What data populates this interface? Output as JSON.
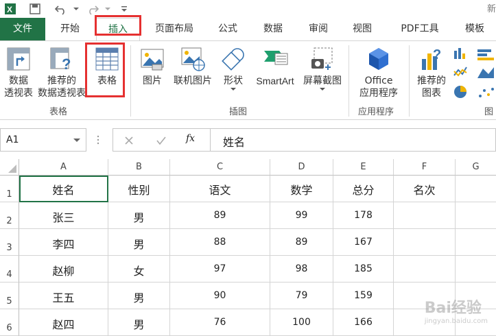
{
  "quick_access": {
    "title_fragment": "新"
  },
  "tabs": [
    {
      "label": "文件",
      "key": "file"
    },
    {
      "label": "开始",
      "key": "home"
    },
    {
      "label": "插入",
      "key": "insert"
    },
    {
      "label": "页面布局",
      "key": "page_layout"
    },
    {
      "label": "公式",
      "key": "formulas"
    },
    {
      "label": "数据",
      "key": "data"
    },
    {
      "label": "审阅",
      "key": "review"
    },
    {
      "label": "视图",
      "key": "view"
    },
    {
      "label": "PDF工具",
      "key": "pdf"
    },
    {
      "label": "模板",
      "key": "template"
    }
  ],
  "ribbon": {
    "pivot_table": "数据\n透视表",
    "recommended_pivot": "推荐的\n数据透视表",
    "table": "表格",
    "tables_group": "表格",
    "picture": "图片",
    "online_picture": "联机图片",
    "shapes": "形状",
    "smartart": "SmartArt",
    "screenshot": "屏幕截图",
    "illustrations_group": "插图",
    "office_apps": "Office\n应用程序",
    "apps_group": "应用程序",
    "recommended_charts": "推荐的\n图表",
    "charts_group_fragment": "图"
  },
  "formula_bar": {
    "name_box": "A1",
    "fx": "fx",
    "value": "姓名"
  },
  "columns": [
    "A",
    "B",
    "C",
    "D",
    "E",
    "F",
    "G"
  ],
  "rows": [
    {
      "n": "1",
      "cells": [
        "姓名",
        "性别",
        "语文",
        "数学",
        "总分",
        "名次"
      ]
    },
    {
      "n": "2",
      "cells": [
        "张三",
        "男",
        "89",
        "99",
        "178",
        ""
      ]
    },
    {
      "n": "3",
      "cells": [
        "李四",
        "男",
        "88",
        "89",
        "167",
        ""
      ]
    },
    {
      "n": "4",
      "cells": [
        "赵柳",
        "女",
        "97",
        "98",
        "185",
        ""
      ]
    },
    {
      "n": "5",
      "cells": [
        "王五",
        "男",
        "90",
        "79",
        "159",
        ""
      ]
    },
    {
      "n": "6",
      "cells": [
        "赵四",
        "男",
        "76",
        "100",
        "166",
        ""
      ]
    }
  ],
  "watermark": {
    "brand": "Bai经验",
    "url": "jingyan.baidu.com"
  },
  "colors": {
    "excel_green": "#217346",
    "highlight_red": "#e53030"
  }
}
